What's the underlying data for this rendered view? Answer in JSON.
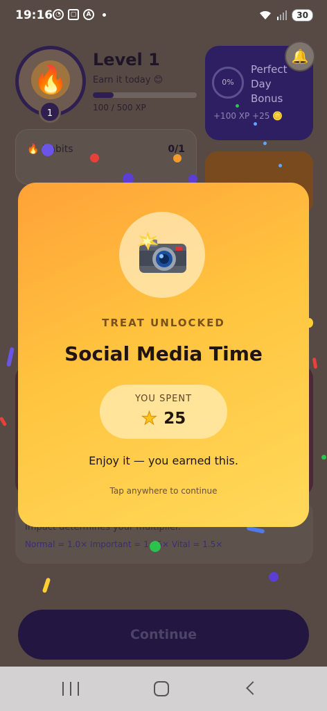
{
  "status_bar": {
    "time": "19:16",
    "battery": "30",
    "icons": [
      "whatsapp-icon",
      "screenshot-icon",
      "app-a-icon",
      "notification-dot",
      "wifi-icon",
      "signal-icon",
      "battery-icon"
    ]
  },
  "header": {
    "level_title": "Level 1",
    "earn_today": "Earn it today 😊",
    "xp_text": "100 / 500 XP",
    "xp_progress": 0.2,
    "avatar_badge": "1"
  },
  "bonus_card": {
    "percent": "0%",
    "title": "Perfect Day Bonus",
    "reward": "+100 XP  +25 🪙"
  },
  "habits_card": {
    "label": "🔥 Habits",
    "count": "0/1"
  },
  "info": {
    "impact_text": "Impact determines your multiplier.",
    "multiplier_text": "Normal = 1.0×   Important = 1.25×   Vital = 1.5×"
  },
  "continue_label": "Continue",
  "modal": {
    "treat_label": "TREAT UNLOCKED",
    "title": "Social Media Time",
    "spent_label": "YOU SPENT",
    "spent_value": "25",
    "enjoy_text": "Enjoy it — you earned this.",
    "tap_text": "Tap anywhere to continue"
  },
  "colors": {
    "modal_gradient_start": "#ffa238",
    "modal_gradient_end": "#ffd95a",
    "primary_purple": "#2e1f62",
    "continue_bg": "#231641"
  }
}
